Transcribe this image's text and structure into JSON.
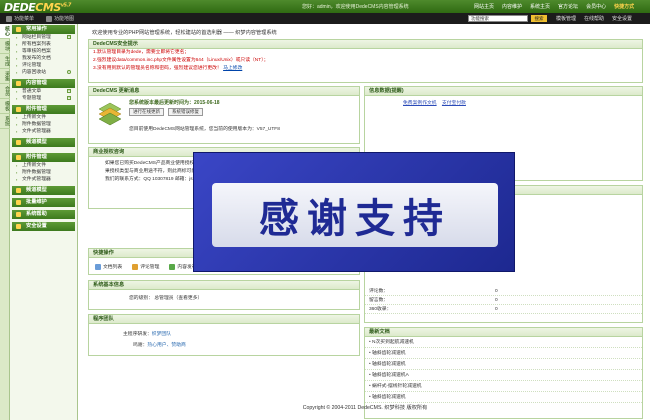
{
  "header": {
    "logo_main": "DEDE",
    "logo_cms": "CMS",
    "logo_ver": "v5.7",
    "welcome": "您好：admin，欢迎使用DedeCMS内容管理系统",
    "nav": [
      "网站主页",
      "内容维护",
      "系统主页",
      "官方论坛",
      "会员中心",
      "快捷方式"
    ],
    "subtabs": [
      "功能菜单",
      "功能地图"
    ],
    "search_value": "功能搜索",
    "search_btn": "搜索",
    "subnav": [
      "模板管理",
      "在线帮助",
      "安全设置"
    ]
  },
  "vtabs": [
    "核心",
    "模块",
    "生成",
    "采集",
    "会员",
    "模板",
    "系统"
  ],
  "sidebar": [
    {
      "head": "常用操作",
      "items": [
        {
          "label": "网站栏目管理",
          "plus": true
        },
        {
          "label": "所有档案列表",
          "plus": false
        },
        {
          "label": "等审核的档案",
          "plus": false
        },
        {
          "label": "我发布的文档",
          "plus": false
        },
        {
          "label": "评论管理",
          "plus": false
        },
        {
          "label": "内容回收站",
          "plus": false
        }
      ]
    },
    {
      "head": "内容管理",
      "items": [
        {
          "label": "普通文章",
          "plus": true
        },
        {
          "label": "专题管理",
          "plus": true
        }
      ]
    },
    {
      "head": "附件管理",
      "items": [
        {
          "label": "上传新文件",
          "plus": false
        },
        {
          "label": "附件数据管理",
          "plus": false
        },
        {
          "label": "文件式管理器",
          "plus": false
        }
      ]
    },
    {
      "head": "频道模型",
      "items": []
    },
    {
      "head": "附件管理",
      "items": [
        {
          "label": "上传新文件",
          "plus": false
        },
        {
          "label": "附件数据管理",
          "plus": false
        },
        {
          "label": "文件式管理器",
          "plus": false
        }
      ]
    },
    {
      "head": "频道模型",
      "items": []
    },
    {
      "head": "批量维护",
      "items": []
    },
    {
      "head": "系统帮助",
      "items": []
    },
    {
      "head": "安全设置",
      "items": []
    }
  ],
  "main": {
    "welcome": "欢迎使用专业的PHP网站管理系统，轻松建站的首选利器 —— 织梦内容管理系统",
    "security": {
      "head": "DedeCMS安全提示",
      "lines": [
        {
          "text": "1.默认管理目录为dede，需要立即将它更名；",
          "link": ""
        },
        {
          "text": "2.强烈建议data/common.inc.php文件属性设置为644（Linux/Unix）或只读（NT）；",
          "link": ""
        },
        {
          "text": "3.没有用到默认的管理员名称和密码，强烈建议您进行更改！",
          "link": "马上修改"
        }
      ]
    },
    "update": {
      "head": "DedeCMS 更新消息",
      "line1": "您系统版本最后更新时间为：2015-06-18",
      "btn1": "进行在线更新",
      "btn2": "系统错误修复",
      "line2": "您目前使用DedeCMS网站管理系统，您当前的使用版本为：V57_UTF8"
    },
    "support": {
      "head": "商业授权咨询",
      "lines": [
        "如果您已购买DedeCMS产品商业使用授权，您可以在我们的授权中心查询到商业授权信息；如",
        "果授权类型与商业用途不符，则此商标可能被侵权；如果您无法登陆授权，请及时同我们取得联系。",
        "我们的联系方式：QQ 10307819  邮箱：jsp@dedecms.com"
      ]
    },
    "quick": {
      "head": "快捷操作",
      "items": [
        "文档列表",
        "评论管理",
        "内容发布",
        "栏目管理",
        "更新主页"
      ]
    },
    "sysinfo": {
      "head": "系统基本信息",
      "label": "您的级别：",
      "value": "总管理员（查看更多）"
    },
    "team": {
      "head": "程序团队",
      "rows": [
        {
          "k": "主程序研发：",
          "v": "织梦团队"
        },
        {
          "k": "鸣谢：",
          "v": "热心用户、赞助商"
        }
      ]
    },
    "official": {
      "head": "信息数据(提醒)",
      "link1": "免费案例作文机",
      "link2": "支付宝付款"
    },
    "stats": {
      "head": "信息统计",
      "rows": [
        {
          "k": "评论数：",
          "v": "0"
        },
        {
          "k": "留言数：",
          "v": "0"
        },
        {
          "k": "360收录：",
          "v": "0"
        }
      ]
    },
    "latest": {
      "head": "最新文档",
      "items": [
        "N次买到起航减速机",
        "轴斜齿轮减速机",
        "轴斜齿轮减速机",
        "轴斜齿轮减速机A",
        "蜗杆式-摆线针轮减速机",
        "轴斜齿轮减速机"
      ]
    }
  },
  "footer": "Copyright © 2004-2011 DedeCMS. 织梦科技 版权所有",
  "overlay": {
    "text": "感谢支持"
  }
}
